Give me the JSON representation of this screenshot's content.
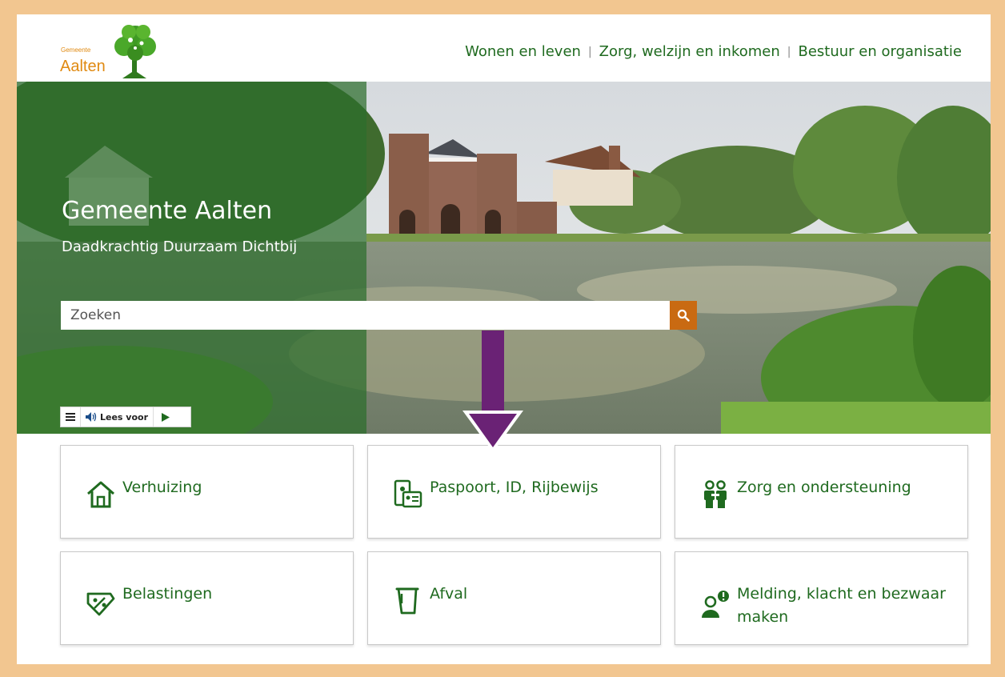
{
  "header": {
    "logo": {
      "small": "Gemeente",
      "big": "Aalten"
    },
    "nav": [
      {
        "label": "Wonen en leven"
      },
      {
        "label": "Zorg, welzijn en inkomen"
      },
      {
        "label": "Bestuur en organisatie"
      }
    ],
    "nav_separator": "|"
  },
  "hero": {
    "title": "Gemeente Aalten",
    "subtitle": "Daadkrachtig Duurzaam Dichtbij",
    "search": {
      "placeholder": "Zoeken",
      "value": ""
    },
    "readspeaker": {
      "label": "Lees voor"
    }
  },
  "tiles": [
    {
      "label": "Verhuizing",
      "icon": "house-icon"
    },
    {
      "label": "Paspoort, ID, Rijbewijs",
      "icon": "id-card-icon"
    },
    {
      "label": "Zorg en ondersteuning",
      "icon": "people-icon"
    },
    {
      "label": "Belastingen",
      "icon": "tax-tag-icon"
    },
    {
      "label": "Afval",
      "icon": "waste-bin-icon"
    },
    {
      "label": "Melding, klacht en bezwaar maken",
      "icon": "report-person-icon"
    }
  ],
  "colors": {
    "brand_green": "#1f6a1f",
    "logo_orange": "#e08a12",
    "search_button": "#c96a12",
    "frame": "#f2c690",
    "annotation_arrow": "#6a2275"
  }
}
